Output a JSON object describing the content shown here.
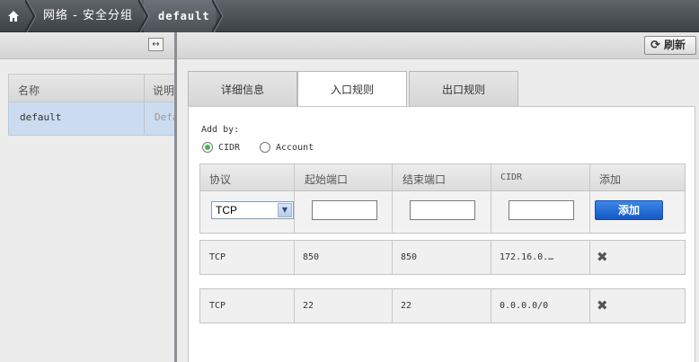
{
  "breadcrumb": {
    "items": [
      "网络 - 安全分组",
      "default"
    ]
  },
  "left": {
    "columns": [
      "名称",
      "说明"
    ],
    "rows": [
      {
        "name": "default",
        "description": "Default"
      }
    ]
  },
  "toolbar": {
    "refresh_label": "刷新"
  },
  "tabs": [
    "详细信息",
    "入口规则",
    "出口规则"
  ],
  "active_tab": "入口规则",
  "add_by": {
    "label": "Add by:",
    "options": [
      "CIDR",
      "Account"
    ],
    "selected": "CIDR"
  },
  "rule_table": {
    "columns": [
      "协议",
      "起始端口",
      "结束端口",
      "CIDR",
      "添加"
    ],
    "new_rule": {
      "protocol": "TCP",
      "start_port": "",
      "end_port": "",
      "cidr": "",
      "add_label": "添加"
    },
    "rules": [
      {
        "protocol": "TCP",
        "start_port": "850",
        "end_port": "850",
        "cidr": "172.16.0.…"
      },
      {
        "protocol": "TCP",
        "start_port": "22",
        "end_port": "22",
        "cidr": "0.0.0.0/0"
      }
    ]
  },
  "colors": {
    "breadcrumb_bg": "#4a4f54",
    "selected_row": "#cbdcf0",
    "add_button": "#1f6fd6",
    "radio_on": "#4db34d"
  },
  "icons": {
    "home": "home-icon",
    "collapse": "collapse-icon",
    "refresh": "refresh-icon",
    "delete": "delete-icon"
  }
}
